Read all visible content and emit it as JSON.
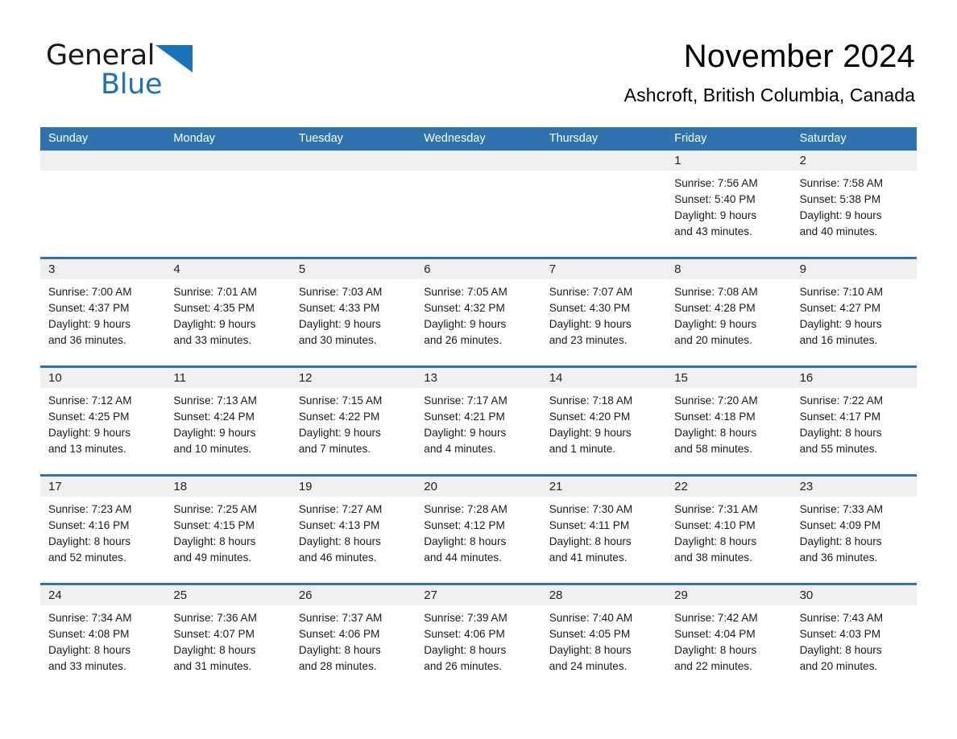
{
  "brand": {
    "line1": "General",
    "line2": "Blue",
    "triangle_color": "#1a72b8",
    "text_color": "#1a1a1a"
  },
  "header": {
    "title": "November 2024",
    "subtitle": "Ashcroft, British Columbia, Canada"
  },
  "theme": {
    "accent_blue": "#2e72b0",
    "daynum_band": "#f0f0f0",
    "cell_background": "#ffffff",
    "page_background": "#ffffff"
  },
  "weekdays": [
    "Sunday",
    "Monday",
    "Tuesday",
    "Wednesday",
    "Thursday",
    "Friday",
    "Saturday"
  ],
  "labels": {
    "sunrise_prefix": "Sunrise:",
    "sunset_prefix": "Sunset:",
    "daylight_prefix": "Daylight:"
  },
  "weeks": [
    [
      {
        "day": "",
        "sunrise": "",
        "sunset": "",
        "daylight_line1": "",
        "daylight_line2": "",
        "empty": true
      },
      {
        "day": "",
        "sunrise": "",
        "sunset": "",
        "daylight_line1": "",
        "daylight_line2": "",
        "empty": true
      },
      {
        "day": "",
        "sunrise": "",
        "sunset": "",
        "daylight_line1": "",
        "daylight_line2": "",
        "empty": true
      },
      {
        "day": "",
        "sunrise": "",
        "sunset": "",
        "daylight_line1": "",
        "daylight_line2": "",
        "empty": true
      },
      {
        "day": "",
        "sunrise": "",
        "sunset": "",
        "daylight_line1": "",
        "daylight_line2": "",
        "empty": true
      },
      {
        "day": "1",
        "sunrise": "Sunrise: 7:56 AM",
        "sunset": "Sunset: 5:40 PM",
        "daylight_line1": "Daylight: 9 hours",
        "daylight_line2": "and 43 minutes.",
        "empty": false
      },
      {
        "day": "2",
        "sunrise": "Sunrise: 7:58 AM",
        "sunset": "Sunset: 5:38 PM",
        "daylight_line1": "Daylight: 9 hours",
        "daylight_line2": "and 40 minutes.",
        "empty": false
      }
    ],
    [
      {
        "day": "3",
        "sunrise": "Sunrise: 7:00 AM",
        "sunset": "Sunset: 4:37 PM",
        "daylight_line1": "Daylight: 9 hours",
        "daylight_line2": "and 36 minutes.",
        "empty": false
      },
      {
        "day": "4",
        "sunrise": "Sunrise: 7:01 AM",
        "sunset": "Sunset: 4:35 PM",
        "daylight_line1": "Daylight: 9 hours",
        "daylight_line2": "and 33 minutes.",
        "empty": false
      },
      {
        "day": "5",
        "sunrise": "Sunrise: 7:03 AM",
        "sunset": "Sunset: 4:33 PM",
        "daylight_line1": "Daylight: 9 hours",
        "daylight_line2": "and 30 minutes.",
        "empty": false
      },
      {
        "day": "6",
        "sunrise": "Sunrise: 7:05 AM",
        "sunset": "Sunset: 4:32 PM",
        "daylight_line1": "Daylight: 9 hours",
        "daylight_line2": "and 26 minutes.",
        "empty": false
      },
      {
        "day": "7",
        "sunrise": "Sunrise: 7:07 AM",
        "sunset": "Sunset: 4:30 PM",
        "daylight_line1": "Daylight: 9 hours",
        "daylight_line2": "and 23 minutes.",
        "empty": false
      },
      {
        "day": "8",
        "sunrise": "Sunrise: 7:08 AM",
        "sunset": "Sunset: 4:28 PM",
        "daylight_line1": "Daylight: 9 hours",
        "daylight_line2": "and 20 minutes.",
        "empty": false
      },
      {
        "day": "9",
        "sunrise": "Sunrise: 7:10 AM",
        "sunset": "Sunset: 4:27 PM",
        "daylight_line1": "Daylight: 9 hours",
        "daylight_line2": "and 16 minutes.",
        "empty": false
      }
    ],
    [
      {
        "day": "10",
        "sunrise": "Sunrise: 7:12 AM",
        "sunset": "Sunset: 4:25 PM",
        "daylight_line1": "Daylight: 9 hours",
        "daylight_line2": "and 13 minutes.",
        "empty": false
      },
      {
        "day": "11",
        "sunrise": "Sunrise: 7:13 AM",
        "sunset": "Sunset: 4:24 PM",
        "daylight_line1": "Daylight: 9 hours",
        "daylight_line2": "and 10 minutes.",
        "empty": false
      },
      {
        "day": "12",
        "sunrise": "Sunrise: 7:15 AM",
        "sunset": "Sunset: 4:22 PM",
        "daylight_line1": "Daylight: 9 hours",
        "daylight_line2": "and 7 minutes.",
        "empty": false
      },
      {
        "day": "13",
        "sunrise": "Sunrise: 7:17 AM",
        "sunset": "Sunset: 4:21 PM",
        "daylight_line1": "Daylight: 9 hours",
        "daylight_line2": "and 4 minutes.",
        "empty": false
      },
      {
        "day": "14",
        "sunrise": "Sunrise: 7:18 AM",
        "sunset": "Sunset: 4:20 PM",
        "daylight_line1": "Daylight: 9 hours",
        "daylight_line2": "and 1 minute.",
        "empty": false
      },
      {
        "day": "15",
        "sunrise": "Sunrise: 7:20 AM",
        "sunset": "Sunset: 4:18 PM",
        "daylight_line1": "Daylight: 8 hours",
        "daylight_line2": "and 58 minutes.",
        "empty": false
      },
      {
        "day": "16",
        "sunrise": "Sunrise: 7:22 AM",
        "sunset": "Sunset: 4:17 PM",
        "daylight_line1": "Daylight: 8 hours",
        "daylight_line2": "and 55 minutes.",
        "empty": false
      }
    ],
    [
      {
        "day": "17",
        "sunrise": "Sunrise: 7:23 AM",
        "sunset": "Sunset: 4:16 PM",
        "daylight_line1": "Daylight: 8 hours",
        "daylight_line2": "and 52 minutes.",
        "empty": false
      },
      {
        "day": "18",
        "sunrise": "Sunrise: 7:25 AM",
        "sunset": "Sunset: 4:15 PM",
        "daylight_line1": "Daylight: 8 hours",
        "daylight_line2": "and 49 minutes.",
        "empty": false
      },
      {
        "day": "19",
        "sunrise": "Sunrise: 7:27 AM",
        "sunset": "Sunset: 4:13 PM",
        "daylight_line1": "Daylight: 8 hours",
        "daylight_line2": "and 46 minutes.",
        "empty": false
      },
      {
        "day": "20",
        "sunrise": "Sunrise: 7:28 AM",
        "sunset": "Sunset: 4:12 PM",
        "daylight_line1": "Daylight: 8 hours",
        "daylight_line2": "and 44 minutes.",
        "empty": false
      },
      {
        "day": "21",
        "sunrise": "Sunrise: 7:30 AM",
        "sunset": "Sunset: 4:11 PM",
        "daylight_line1": "Daylight: 8 hours",
        "daylight_line2": "and 41 minutes.",
        "empty": false
      },
      {
        "day": "22",
        "sunrise": "Sunrise: 7:31 AM",
        "sunset": "Sunset: 4:10 PM",
        "daylight_line1": "Daylight: 8 hours",
        "daylight_line2": "and 38 minutes.",
        "empty": false
      },
      {
        "day": "23",
        "sunrise": "Sunrise: 7:33 AM",
        "sunset": "Sunset: 4:09 PM",
        "daylight_line1": "Daylight: 8 hours",
        "daylight_line2": "and 36 minutes.",
        "empty": false
      }
    ],
    [
      {
        "day": "24",
        "sunrise": "Sunrise: 7:34 AM",
        "sunset": "Sunset: 4:08 PM",
        "daylight_line1": "Daylight: 8 hours",
        "daylight_line2": "and 33 minutes.",
        "empty": false
      },
      {
        "day": "25",
        "sunrise": "Sunrise: 7:36 AM",
        "sunset": "Sunset: 4:07 PM",
        "daylight_line1": "Daylight: 8 hours",
        "daylight_line2": "and 31 minutes.",
        "empty": false
      },
      {
        "day": "26",
        "sunrise": "Sunrise: 7:37 AM",
        "sunset": "Sunset: 4:06 PM",
        "daylight_line1": "Daylight: 8 hours",
        "daylight_line2": "and 28 minutes.",
        "empty": false
      },
      {
        "day": "27",
        "sunrise": "Sunrise: 7:39 AM",
        "sunset": "Sunset: 4:06 PM",
        "daylight_line1": "Daylight: 8 hours",
        "daylight_line2": "and 26 minutes.",
        "empty": false
      },
      {
        "day": "28",
        "sunrise": "Sunrise: 7:40 AM",
        "sunset": "Sunset: 4:05 PM",
        "daylight_line1": "Daylight: 8 hours",
        "daylight_line2": "and 24 minutes.",
        "empty": false
      },
      {
        "day": "29",
        "sunrise": "Sunrise: 7:42 AM",
        "sunset": "Sunset: 4:04 PM",
        "daylight_line1": "Daylight: 8 hours",
        "daylight_line2": "and 22 minutes.",
        "empty": false
      },
      {
        "day": "30",
        "sunrise": "Sunrise: 7:43 AM",
        "sunset": "Sunset: 4:03 PM",
        "daylight_line1": "Daylight: 8 hours",
        "daylight_line2": "and 20 minutes.",
        "empty": false
      }
    ]
  ]
}
